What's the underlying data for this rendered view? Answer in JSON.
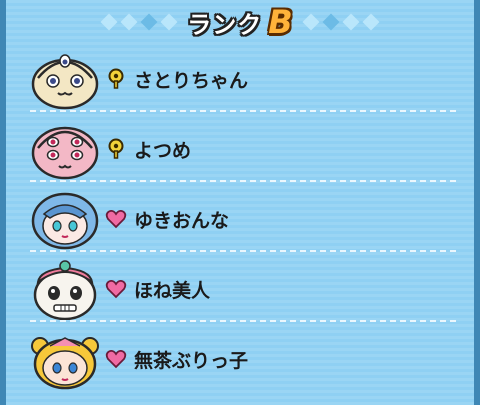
{
  "header": {
    "title": "ランク",
    "rank": "B"
  },
  "entries": [
    {
      "name": "さとりちゃん",
      "badge": "yellow-key-icon",
      "avatar": "satori-chan-face-icon"
    },
    {
      "name": "よつめ",
      "badge": "yellow-key-icon",
      "avatar": "yotsume-face-icon"
    },
    {
      "name": "ゆきおんな",
      "badge": "pink-heart-icon",
      "avatar": "yuki-onna-face-icon"
    },
    {
      "name": "ほね美人",
      "badge": "pink-heart-icon",
      "avatar": "hone-bijin-face-icon"
    },
    {
      "name": "無茶ぶりっ子",
      "badge": "pink-heart-icon",
      "avatar": "mucha-burikko-face-icon"
    }
  ],
  "colors": {
    "background": "#8fd0f3",
    "frame": "#3f87b5",
    "rank": "#ffb33a",
    "heart": "#f06aa3",
    "key": "#f2d33a"
  }
}
